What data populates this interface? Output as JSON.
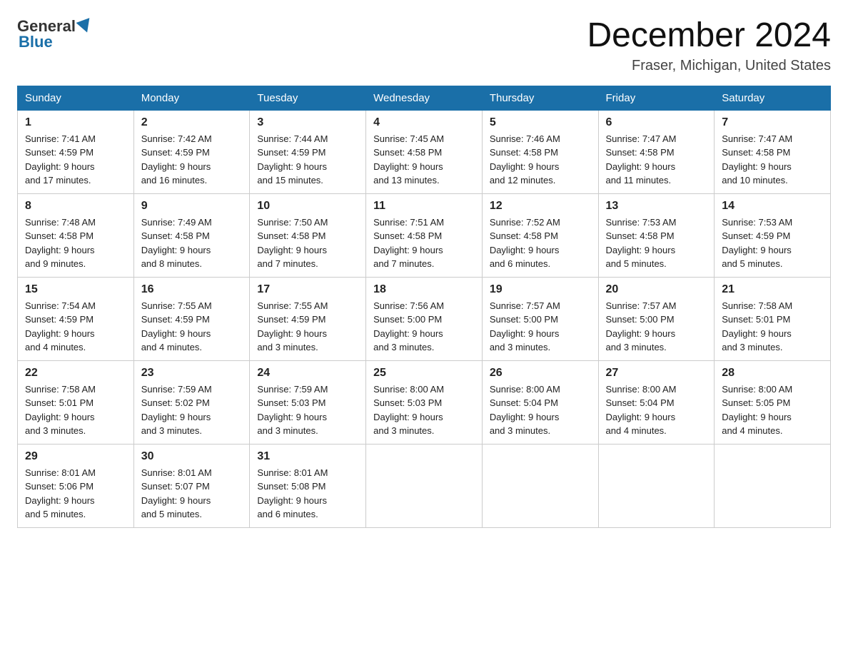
{
  "header": {
    "logo_general": "General",
    "logo_blue": "Blue",
    "month_year": "December 2024",
    "location": "Fraser, Michigan, United States"
  },
  "days_of_week": [
    "Sunday",
    "Monday",
    "Tuesday",
    "Wednesday",
    "Thursday",
    "Friday",
    "Saturday"
  ],
  "weeks": [
    [
      {
        "day": "1",
        "sunrise": "7:41 AM",
        "sunset": "4:59 PM",
        "daylight": "9 hours and 17 minutes."
      },
      {
        "day": "2",
        "sunrise": "7:42 AM",
        "sunset": "4:59 PM",
        "daylight": "9 hours and 16 minutes."
      },
      {
        "day": "3",
        "sunrise": "7:44 AM",
        "sunset": "4:59 PM",
        "daylight": "9 hours and 15 minutes."
      },
      {
        "day": "4",
        "sunrise": "7:45 AM",
        "sunset": "4:58 PM",
        "daylight": "9 hours and 13 minutes."
      },
      {
        "day": "5",
        "sunrise": "7:46 AM",
        "sunset": "4:58 PM",
        "daylight": "9 hours and 12 minutes."
      },
      {
        "day": "6",
        "sunrise": "7:47 AM",
        "sunset": "4:58 PM",
        "daylight": "9 hours and 11 minutes."
      },
      {
        "day": "7",
        "sunrise": "7:47 AM",
        "sunset": "4:58 PM",
        "daylight": "9 hours and 10 minutes."
      }
    ],
    [
      {
        "day": "8",
        "sunrise": "7:48 AM",
        "sunset": "4:58 PM",
        "daylight": "9 hours and 9 minutes."
      },
      {
        "day": "9",
        "sunrise": "7:49 AM",
        "sunset": "4:58 PM",
        "daylight": "9 hours and 8 minutes."
      },
      {
        "day": "10",
        "sunrise": "7:50 AM",
        "sunset": "4:58 PM",
        "daylight": "9 hours and 7 minutes."
      },
      {
        "day": "11",
        "sunrise": "7:51 AM",
        "sunset": "4:58 PM",
        "daylight": "9 hours and 7 minutes."
      },
      {
        "day": "12",
        "sunrise": "7:52 AM",
        "sunset": "4:58 PM",
        "daylight": "9 hours and 6 minutes."
      },
      {
        "day": "13",
        "sunrise": "7:53 AM",
        "sunset": "4:58 PM",
        "daylight": "9 hours and 5 minutes."
      },
      {
        "day": "14",
        "sunrise": "7:53 AM",
        "sunset": "4:59 PM",
        "daylight": "9 hours and 5 minutes."
      }
    ],
    [
      {
        "day": "15",
        "sunrise": "7:54 AM",
        "sunset": "4:59 PM",
        "daylight": "9 hours and 4 minutes."
      },
      {
        "day": "16",
        "sunrise": "7:55 AM",
        "sunset": "4:59 PM",
        "daylight": "9 hours and 4 minutes."
      },
      {
        "day": "17",
        "sunrise": "7:55 AM",
        "sunset": "4:59 PM",
        "daylight": "9 hours and 3 minutes."
      },
      {
        "day": "18",
        "sunrise": "7:56 AM",
        "sunset": "5:00 PM",
        "daylight": "9 hours and 3 minutes."
      },
      {
        "day": "19",
        "sunrise": "7:57 AM",
        "sunset": "5:00 PM",
        "daylight": "9 hours and 3 minutes."
      },
      {
        "day": "20",
        "sunrise": "7:57 AM",
        "sunset": "5:00 PM",
        "daylight": "9 hours and 3 minutes."
      },
      {
        "day": "21",
        "sunrise": "7:58 AM",
        "sunset": "5:01 PM",
        "daylight": "9 hours and 3 minutes."
      }
    ],
    [
      {
        "day": "22",
        "sunrise": "7:58 AM",
        "sunset": "5:01 PM",
        "daylight": "9 hours and 3 minutes."
      },
      {
        "day": "23",
        "sunrise": "7:59 AM",
        "sunset": "5:02 PM",
        "daylight": "9 hours and 3 minutes."
      },
      {
        "day": "24",
        "sunrise": "7:59 AM",
        "sunset": "5:03 PM",
        "daylight": "9 hours and 3 minutes."
      },
      {
        "day": "25",
        "sunrise": "8:00 AM",
        "sunset": "5:03 PM",
        "daylight": "9 hours and 3 minutes."
      },
      {
        "day": "26",
        "sunrise": "8:00 AM",
        "sunset": "5:04 PM",
        "daylight": "9 hours and 3 minutes."
      },
      {
        "day": "27",
        "sunrise": "8:00 AM",
        "sunset": "5:04 PM",
        "daylight": "9 hours and 4 minutes."
      },
      {
        "day": "28",
        "sunrise": "8:00 AM",
        "sunset": "5:05 PM",
        "daylight": "9 hours and 4 minutes."
      }
    ],
    [
      {
        "day": "29",
        "sunrise": "8:01 AM",
        "sunset": "5:06 PM",
        "daylight": "9 hours and 5 minutes."
      },
      {
        "day": "30",
        "sunrise": "8:01 AM",
        "sunset": "5:07 PM",
        "daylight": "9 hours and 5 minutes."
      },
      {
        "day": "31",
        "sunrise": "8:01 AM",
        "sunset": "5:08 PM",
        "daylight": "9 hours and 6 minutes."
      },
      null,
      null,
      null,
      null
    ]
  ],
  "labels": {
    "sunrise": "Sunrise:",
    "sunset": "Sunset:",
    "daylight": "Daylight:"
  }
}
